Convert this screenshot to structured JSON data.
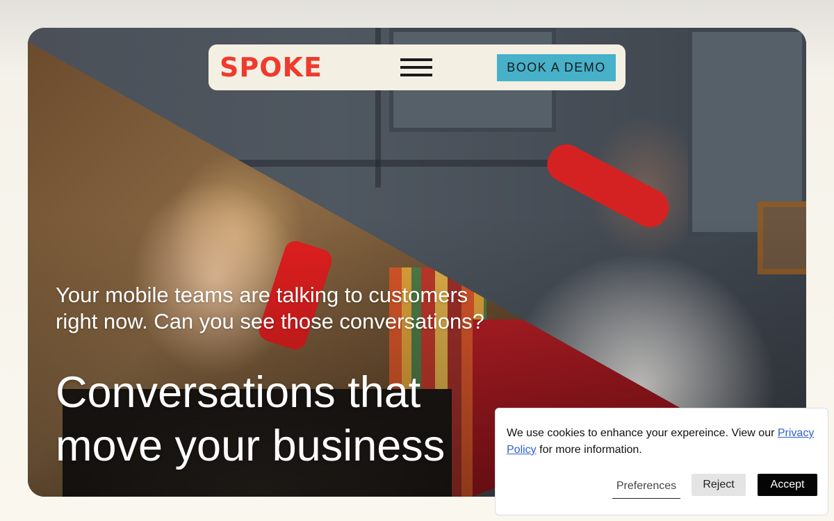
{
  "nav": {
    "logo": "SPOKE",
    "menu_icon": "hamburger-menu-icon",
    "cta_label": "BOOK A DEMO"
  },
  "hero": {
    "tagline": "Your mobile teams are talking to customers right now. Can you see those conversations?",
    "headline": "Conversations that move your business"
  },
  "cookie_banner": {
    "text_before": "We use cookies to enhance your expereince. View our ",
    "link_label": "Privacy Policy",
    "text_after": " for more information.",
    "preferences_label": "Preferences",
    "reject_label": "Reject",
    "accept_label": "Accept"
  },
  "colors": {
    "brand": "#ef3b2d",
    "cta": "#46b1c9",
    "nav_bg": "#f3efe3",
    "link": "#2d5fd3"
  }
}
